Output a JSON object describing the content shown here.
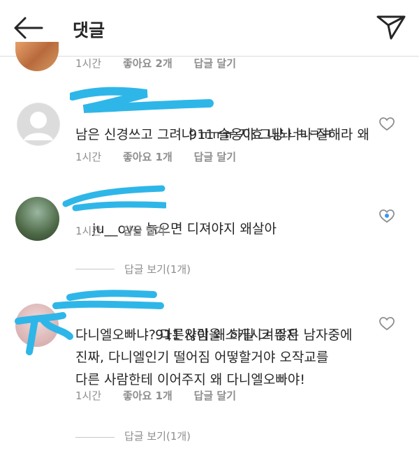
{
  "header": {
    "title": "댓글"
  },
  "comments": [
    {
      "time": "1시간",
      "likes": "좋아요 2개",
      "reply": "답글 달기"
    },
    {
      "username_fragment": "911",
      "line1": "슬옹아 그냥 너나 잘해라 왜",
      "line2": "남은 신경쓰고 그려냐 ㅠㅠㅠ 지효 내놔 ㅋㅋㅋ",
      "time": "1시간",
      "likes": "좋아요 1개",
      "reply": "답글 달기"
    },
    {
      "username_fragment": "ju__ove",
      "line1": "늙으면 디져야지 왜살아",
      "time": "1시간",
      "reply": "답글 달기",
      "view_replies": "답글 보기(1개)"
    },
    {
      "username_fragment": "911",
      "line1": "않이 왜 하필 그 많은 남자중에",
      "line2": "다니엘오빠냐? 다른사람을 소개시켜주지",
      "line3": "진짜, 다니엘인기 떨어짐 어떻할거야 오작교를",
      "line4": "다른 사람한테 이어주지 왜 다니엘오빠야!",
      "time": "1시간",
      "likes": "좋아요 1개",
      "reply": "답글 달기",
      "view_replies": "답글 보기(1개)"
    }
  ],
  "colors": {
    "scribble": "#2fb6e8",
    "text": "#262626",
    "meta": "#8e8e8e"
  }
}
